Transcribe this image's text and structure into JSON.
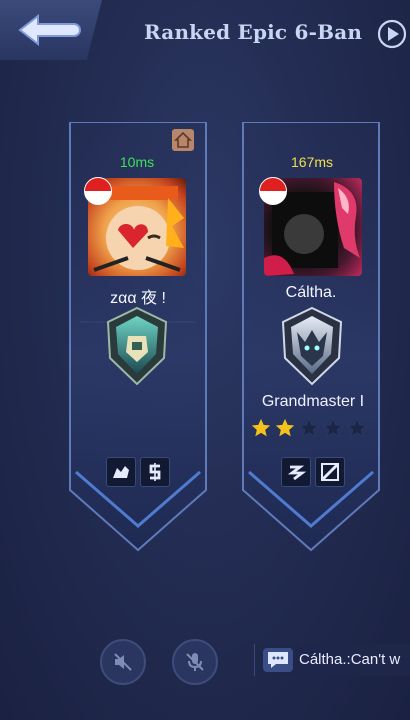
{
  "header": {
    "title": "Ranked Epic 6-Ban"
  },
  "players": [
    {
      "ping": "10ms",
      "name": "zαα 夜 !",
      "spells": [
        "retribution-icon",
        "purify-icon"
      ]
    },
    {
      "ping": "167ms",
      "name": "Cáltha.",
      "rank": "Grandmaster I",
      "stars": {
        "filled": 2,
        "total": 5
      },
      "spells": [
        "sprint-icon",
        "flicker-icon"
      ]
    }
  ],
  "chat": {
    "preview": "Cáltha.:Can't w"
  },
  "colors": {
    "ping_good": "#3ee05a",
    "ping_mid": "#f2e04a",
    "star_filled": "#f4c21a",
    "star_empty": "#1b2546"
  }
}
